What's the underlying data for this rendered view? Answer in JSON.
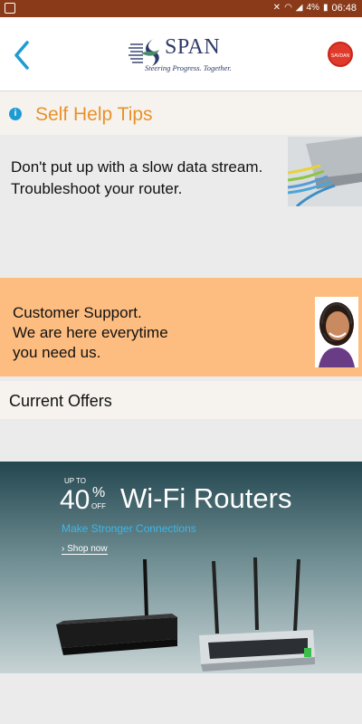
{
  "status_bar": {
    "battery": "4%",
    "time": "06:48"
  },
  "header": {
    "logo_name": "SPAN",
    "logo_tagline": "Steering Progress. Together.",
    "badge_text": "SAVDAN"
  },
  "tips": {
    "title": "Self Help Tips"
  },
  "router_tip": {
    "line1": "Don't put up with a slow data stream.",
    "line2": "Troubleshoot your router."
  },
  "support": {
    "line1": "Customer Support.",
    "line2": "We are here everytime",
    "line3": "you need us."
  },
  "offers": {
    "title": "Current Offers"
  },
  "banner": {
    "upto": "UP TO",
    "percent": "40",
    "percent_sign": "%",
    "off": "OFF",
    "title": "Wi-Fi Routers",
    "subtitle": "Make Stronger Connections",
    "shop_link": "› Shop now"
  },
  "colors": {
    "status_bar": "#8a3a18",
    "accent_orange": "#e9912b",
    "support_bg": "#fdbd80",
    "info_blue": "#1e9bd3",
    "back_blue": "#1e9bd3"
  }
}
